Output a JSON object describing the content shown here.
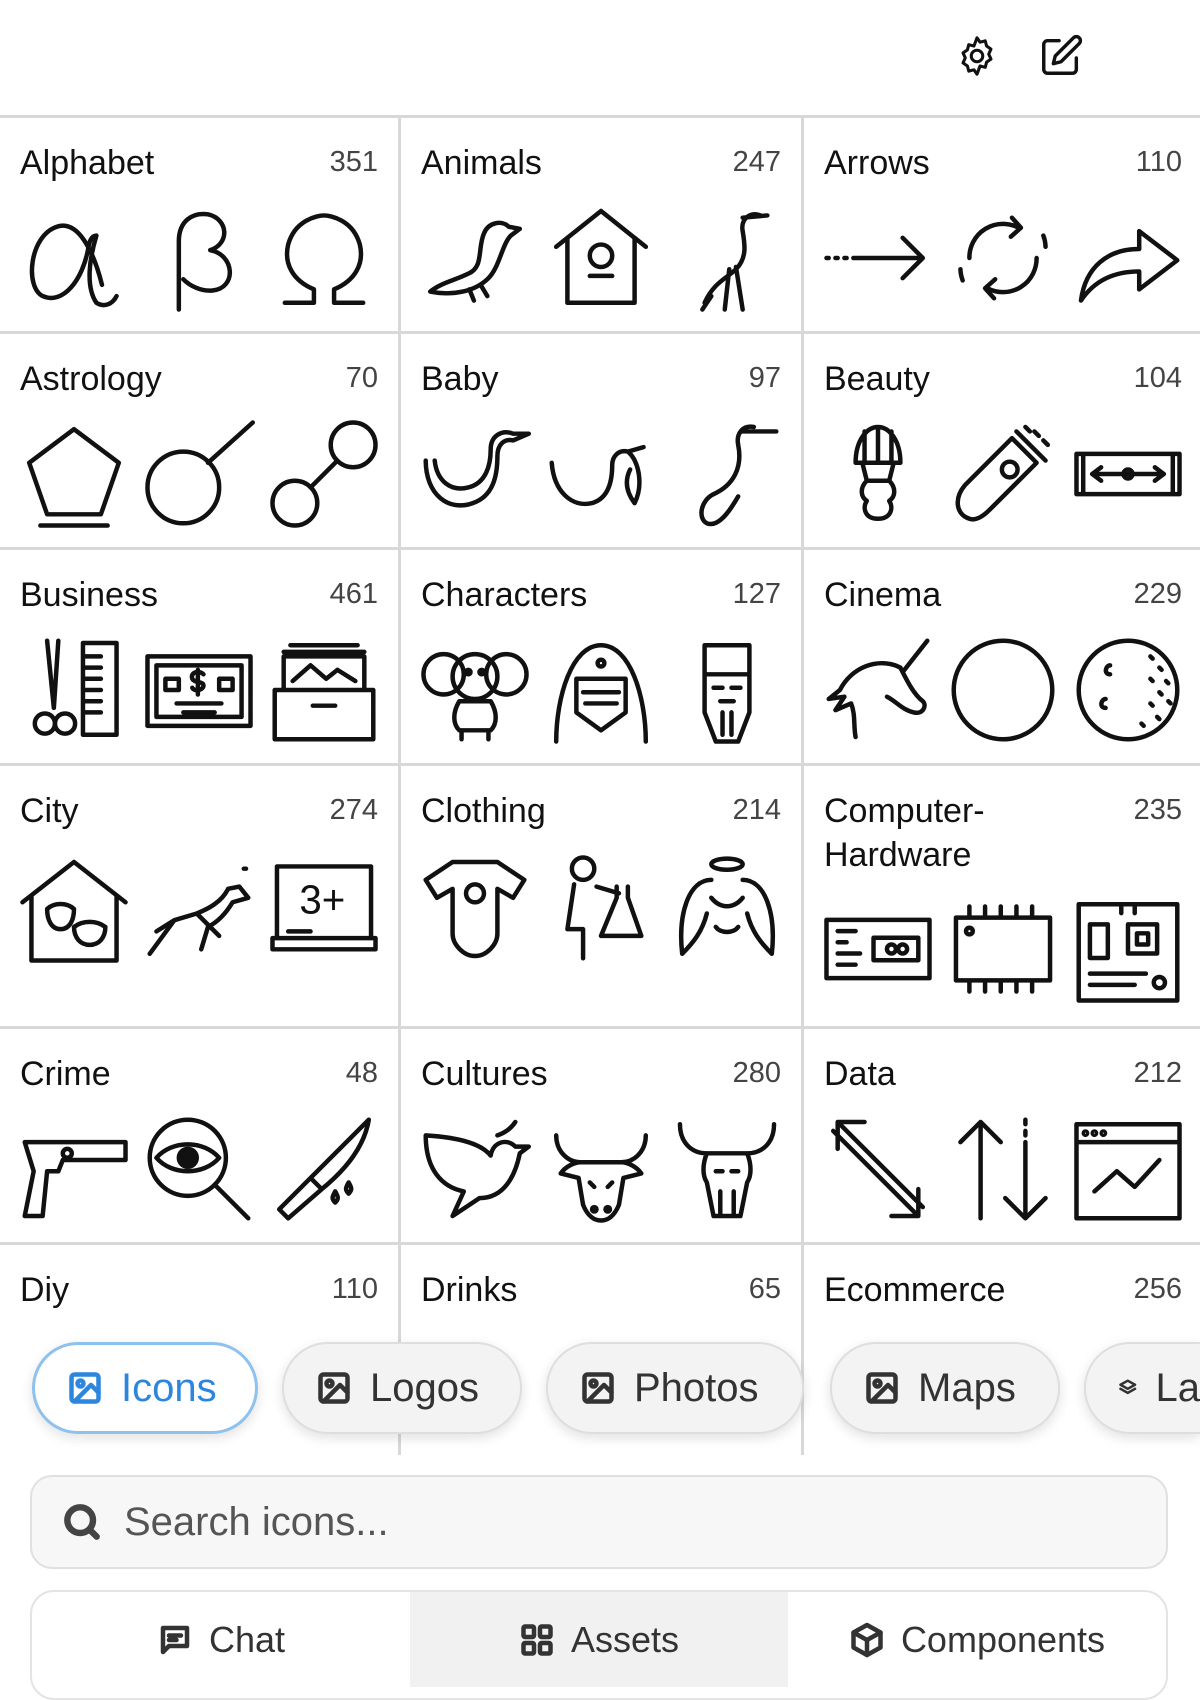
{
  "toolbar": {
    "settings_icon": "gear-icon",
    "edit_icon": "edit-icon"
  },
  "categories": [
    {
      "name": "Alphabet",
      "count": "351"
    },
    {
      "name": "Animals",
      "count": "247"
    },
    {
      "name": "Arrows",
      "count": "110"
    },
    {
      "name": "Astrology",
      "count": "70"
    },
    {
      "name": "Baby",
      "count": "97"
    },
    {
      "name": "Beauty",
      "count": "104"
    },
    {
      "name": "Business",
      "count": "461"
    },
    {
      "name": "Characters",
      "count": "127"
    },
    {
      "name": "Cinema",
      "count": "229"
    },
    {
      "name": "City",
      "count": "274"
    },
    {
      "name": "Clothing",
      "count": "214"
    },
    {
      "name": "Computer-Hardware",
      "count": "235"
    },
    {
      "name": "Crime",
      "count": "48"
    },
    {
      "name": "Cultures",
      "count": "280"
    },
    {
      "name": "Data",
      "count": "212"
    },
    {
      "name": "Diy",
      "count": "110"
    },
    {
      "name": "Drinks",
      "count": "65"
    },
    {
      "name": "Ecommerce",
      "count": "256"
    }
  ],
  "asset_types": [
    {
      "label": "Icons",
      "active": true
    },
    {
      "label": "Logos",
      "active": false
    },
    {
      "label": "Photos",
      "active": false
    },
    {
      "label": "Maps",
      "active": false
    },
    {
      "label": "La",
      "active": false
    }
  ],
  "search": {
    "placeholder": "Search icons..."
  },
  "bottom_tabs": [
    {
      "label": "Chat"
    },
    {
      "label": "Assets"
    },
    {
      "label": "Components"
    }
  ],
  "colors": {
    "accent": "#2d86dd",
    "accent_border": "#8ec1ee",
    "grid_line": "#d8d8d8"
  }
}
